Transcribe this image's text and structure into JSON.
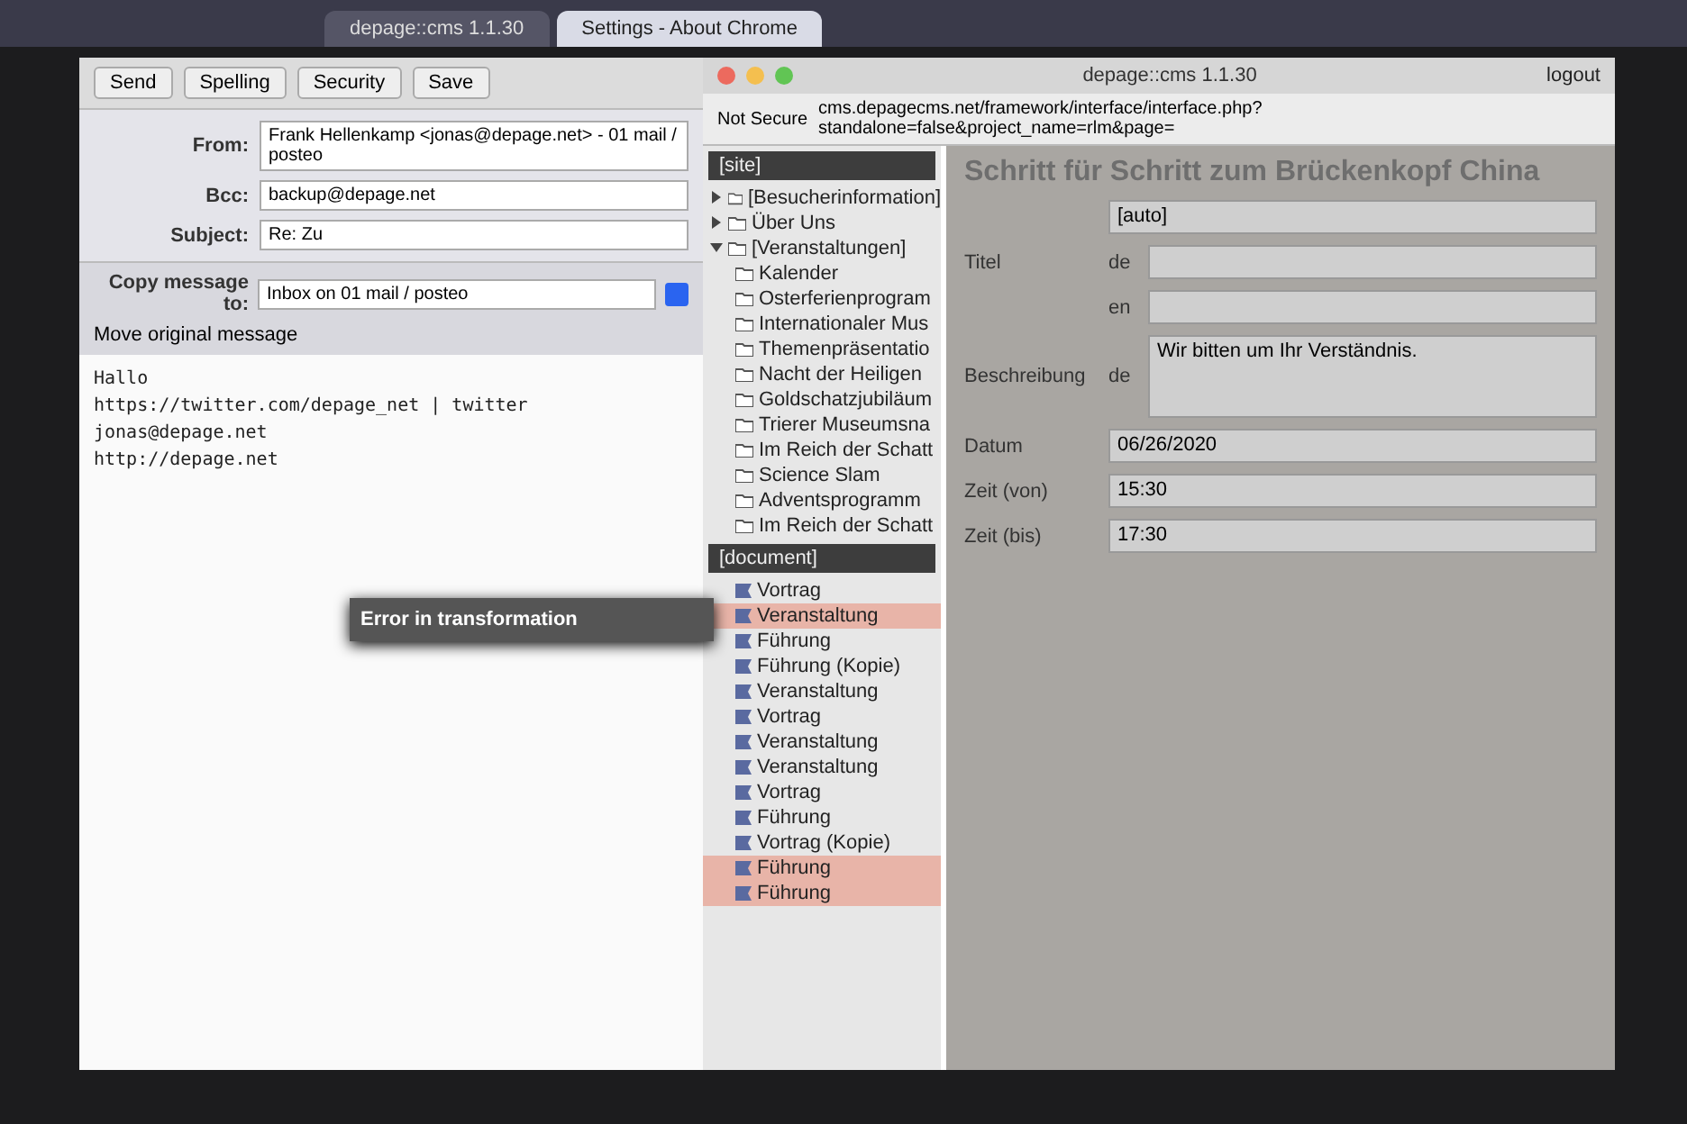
{
  "browser_tabs": [
    {
      "label": "depage::cms 1.1.30",
      "selected": false
    },
    {
      "label": "Settings - About Chrome",
      "selected": true
    }
  ],
  "mail": {
    "toolbar": [
      "Send",
      "Spelling",
      "Security",
      "Save"
    ],
    "fields": [
      {
        "label": "From:",
        "value": "Frank Hellenkamp <jonas@depage.net> - 01 mail / posteo"
      },
      {
        "label": "Bcc:",
        "value": "backup@depage.net"
      },
      {
        "label": "Subject:",
        "value": "Re: Zu"
      }
    ],
    "copy_to": {
      "label": "Copy message to:",
      "value": "Inbox on 01 mail / posteo",
      "move_original": true,
      "move_label": "Move original message"
    },
    "body": [
      "Hallo",
      "https://twitter.com/depage_net | twitter",
      "jonas@depage.net",
      "http://depage.net"
    ],
    "error": {
      "title": "Error in transformation"
    }
  },
  "cms": {
    "title": "depage::cms 1.1.30",
    "logout": "logout",
    "address": {
      "security": "Not Secure",
      "url": "cms.depagecms.net/framework/interface/interface.php?standalone=false&project_name=rlm&page="
    },
    "site_select": "[site]",
    "tree": [
      {
        "label": "[Besucherinformation]",
        "expanded": false
      },
      {
        "label": "Über Uns",
        "expanded": false
      },
      {
        "label": "[Veranstaltungen]",
        "expanded": true,
        "children": [
          {
            "label": "Kalender"
          },
          {
            "label": "Osterferienprogram"
          },
          {
            "label": "Internationaler Mus"
          },
          {
            "label": "Themenpräsentatio"
          },
          {
            "label": "Nacht der Heiligen"
          },
          {
            "label": "Goldschatzjubiläum"
          },
          {
            "label": "Trierer Museumsna"
          },
          {
            "label": "Im Reich der Schatt"
          },
          {
            "label": "Science Slam"
          },
          {
            "label": "Adventsprogramm"
          },
          {
            "label": "Im Reich der Schatt"
          }
        ]
      }
    ],
    "document_select": "[document]",
    "document": [
      {
        "label": "Vortrag",
        "selected": false
      },
      {
        "label": "Veranstaltung",
        "selected": true
      },
      {
        "label": "Führung",
        "selected": false
      },
      {
        "label": "Führung (Kopie)",
        "selected": false
      },
      {
        "label": "Veranstaltung",
        "selected": false
      },
      {
        "label": "Vortrag",
        "selected": false
      },
      {
        "label": "Veranstaltung",
        "selected": false
      },
      {
        "label": "Veranstaltung",
        "selected": false
      },
      {
        "label": "Vortrag",
        "selected": false
      },
      {
        "label": "Führung",
        "selected": false
      },
      {
        "label": "Vortrag (Kopie)",
        "selected": false
      },
      {
        "label": "Führung",
        "selected": true
      },
      {
        "label": "Führung",
        "selected": true
      }
    ],
    "headline": "Schritt für Schritt zum Brückenkopf China",
    "form": [
      {
        "kind": "select",
        "value": "[auto]"
      },
      {
        "kind": "text",
        "label": "Titel",
        "lang": "de"
      },
      {
        "kind": "text",
        "lang": "en"
      },
      {
        "kind": "area",
        "label": "Beschreibung",
        "lang": "de",
        "value": "Wir bitten um Ihr Verständnis."
      },
      {
        "kind": "text",
        "label": "Datum",
        "value": "06/26/2020"
      },
      {
        "kind": "text",
        "label": "Zeit (von)",
        "value": "15:30"
      },
      {
        "kind": "text",
        "label": "Zeit (bis)",
        "value": "17:30"
      }
    ]
  }
}
